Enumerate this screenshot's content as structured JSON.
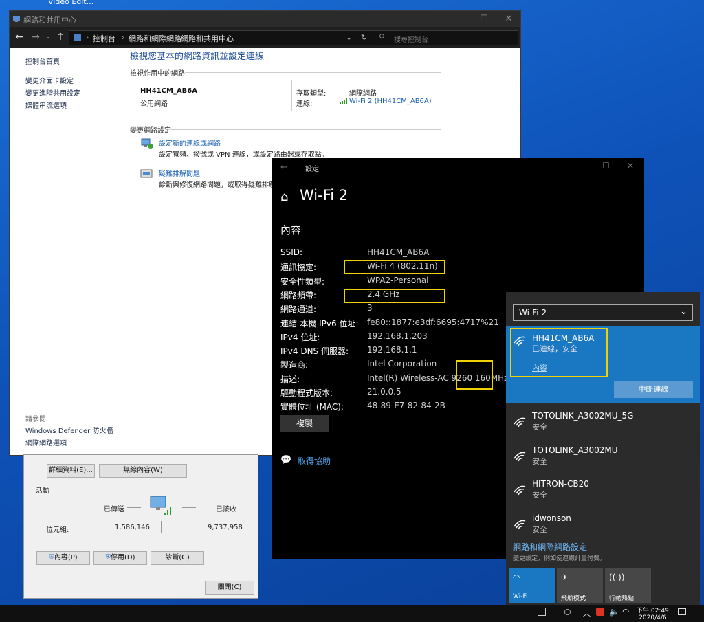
{
  "desktop": {
    "label": "Video Edit..."
  },
  "control_panel": {
    "title": "網路和共用中心",
    "breadcrumb": [
      "控制台",
      "網路和網際網路",
      "網路和共用中心"
    ],
    "search_placeholder": "搜尋控制台",
    "left_links": [
      "控制台首頁",
      "變更介面卡設定",
      "變更進階共用設定",
      "媒體串流選項"
    ],
    "see_also_title": "請參閱",
    "see_also_links": [
      "Windows Defender 防火牆",
      "網際網路選項"
    ],
    "heading": "檢視您基本的網路資訊並設定連線",
    "active_networks_title": "檢視作用中的網路",
    "network_name": "HH41CM_AB6A",
    "network_type": "公用網路",
    "access_type_label": "存取類型:",
    "access_type_value": "網際網路",
    "connection_label": "連線:",
    "connection_value": "Wi-Fi 2 (HH41CM_AB6A)",
    "change_settings_title": "變更網路設定",
    "task1_link": "設定新的連線或網路",
    "task1_desc": "設定寬頻、撥號或 VPN 連線，或設定路由器或存取點。",
    "task2_link": "疑難排解問題",
    "task2_desc": "診斷與修復網路問題，或取得疑難排解資"
  },
  "wifi_status": {
    "details_button": "詳細資料(E)...",
    "wireless_props_button": "無線內容(W)",
    "activity_title": "活動",
    "sent_label": "已傳送",
    "received_label": "已接收",
    "bytes_label": "位元組:",
    "bytes_sent": "1,586,146",
    "bytes_received": "9,737,958",
    "properties_button": "內容(P)",
    "disable_button": "停用(D)",
    "diagnose_button": "診斷(G)",
    "close_button": "關閉(C)"
  },
  "settings": {
    "window_title": "設定",
    "page_title": "Wi-Fi 2",
    "section_title": "內容",
    "rows": [
      {
        "label": "SSID:",
        "value": "HH41CM_AB6A"
      },
      {
        "label": "通訊協定:",
        "value": "Wi-Fi 4 (802.11n)"
      },
      {
        "label": "安全性類型:",
        "value": "WPA2-Personal"
      },
      {
        "label": "網路頻帶:",
        "value": "2.4 GHz"
      },
      {
        "label": "網路通道:",
        "value": "3"
      },
      {
        "label": "連結-本機 IPv6 位址:",
        "value": "fe80::1877:e3df:6695:4717%21"
      },
      {
        "label": "IPv4 位址:",
        "value": "192.168.1.203"
      },
      {
        "label": "IPv4 DNS 伺服器:",
        "value": "192.168.1.1"
      },
      {
        "label": "製造商:",
        "value": "Intel Corporation"
      },
      {
        "label": "描述:",
        "value": "Intel(R) Wireless-AC 9260 160MHz"
      },
      {
        "label": "驅動程式版本:",
        "value": "21.0.0.5"
      },
      {
        "label": "實體位址 (MAC):",
        "value": "48-89-E7-82-84-2B"
      }
    ],
    "copy_button": "複製",
    "help_link": "取得協助",
    "highlight_color": "#f2d100"
  },
  "flyout": {
    "adapter": "Wi-Fi 2",
    "connected": {
      "name": "HH41CM_AB6A",
      "status": "已連線，安全",
      "properties_link": "內容",
      "disconnect_button": "中斷連線"
    },
    "networks": [
      {
        "name": "TOTOLINK_A3002MU_5G",
        "status": "安全"
      },
      {
        "name": "TOTOLINK_A3002MU",
        "status": "安全"
      },
      {
        "name": "HITRON-CB20",
        "status": "安全"
      },
      {
        "name": "idwonson",
        "status": "安全"
      }
    ],
    "settings_link": "網路和網際網路設定",
    "settings_desc": "變更設定，例如使連線計量付費。",
    "tiles": [
      "Wi-Fi",
      "飛航模式",
      "行動熱點"
    ],
    "accent": "#1a78c2"
  },
  "taskbar": {
    "time": "下午 02:49",
    "date": "2020/4/6"
  }
}
